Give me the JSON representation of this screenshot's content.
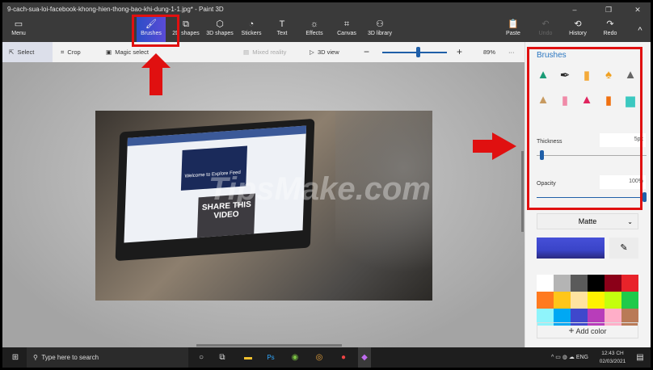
{
  "window": {
    "title": "9-cach-sua-loi-facebook-khong-hien-thong-bao-khi-dung-1-1.jpg* - Paint 3D",
    "minimize": "–",
    "restore": "❐",
    "close": "✕"
  },
  "toolbar": {
    "menu": "Menu",
    "items": [
      {
        "label": "Brushes",
        "icon": "brush-icon"
      },
      {
        "label": "2D shapes",
        "icon": "2d-shapes-icon"
      },
      {
        "label": "3D shapes",
        "icon": "3d-shapes-icon"
      },
      {
        "label": "Stickers",
        "icon": "stickers-icon"
      },
      {
        "label": "Text",
        "icon": "text-icon"
      },
      {
        "label": "Effects",
        "icon": "effects-icon"
      },
      {
        "label": "Canvas",
        "icon": "canvas-icon"
      },
      {
        "label": "3D library",
        "icon": "3d-library-icon"
      }
    ],
    "paste": "Paste",
    "undo": "Undo",
    "history": "History",
    "redo": "Redo",
    "active": "Brushes"
  },
  "subbar": {
    "select": "Select",
    "crop": "Crop",
    "magic_select": "Magic select",
    "mixed_reality": "Mixed reality",
    "view3d": "3D view",
    "zoom": "89%",
    "more": "···",
    "zoom_level": 0.6
  },
  "canvas_image": {
    "screen_heading": "Welcome to Explore Feed",
    "share_text": "SHARE THIS VIDEO",
    "watermark": "TipsMake.com"
  },
  "panel": {
    "title": "Brushes",
    "brushes": [
      "Marker",
      "Calligraphy pen",
      "Oil brush",
      "Watercolor",
      "Pixel pen",
      "Pencil",
      "Eraser",
      "Crayon",
      "Spray can",
      "Fill"
    ],
    "thickness_label": "Thickness",
    "thickness": "5px",
    "thickness_fraction": 0.03,
    "opacity_label": "Opacity",
    "opacity": "100%",
    "opacity_fraction": 1.0,
    "finish": "Matte",
    "current_color": "#3a44c8",
    "palette": [
      "#ffffff",
      "#b4b4b4",
      "#5a5a5a",
      "#000000",
      "#8b0018",
      "#e8232a",
      "#ff7a1f",
      "#ffc61a",
      "#ffe3a0",
      "#fff200",
      "#c4ff0e",
      "#1fca4a",
      "#8ff4fb",
      "#00a8f3",
      "#3f48cc",
      "#b83dba",
      "#ffaec8",
      "#b97a57"
    ],
    "add_color": "Add color"
  },
  "taskbar": {
    "search_placeholder": "Type here to search",
    "language": "ENG",
    "time": "12:43 CH",
    "date": "02/03/2021",
    "notifications": "1"
  }
}
